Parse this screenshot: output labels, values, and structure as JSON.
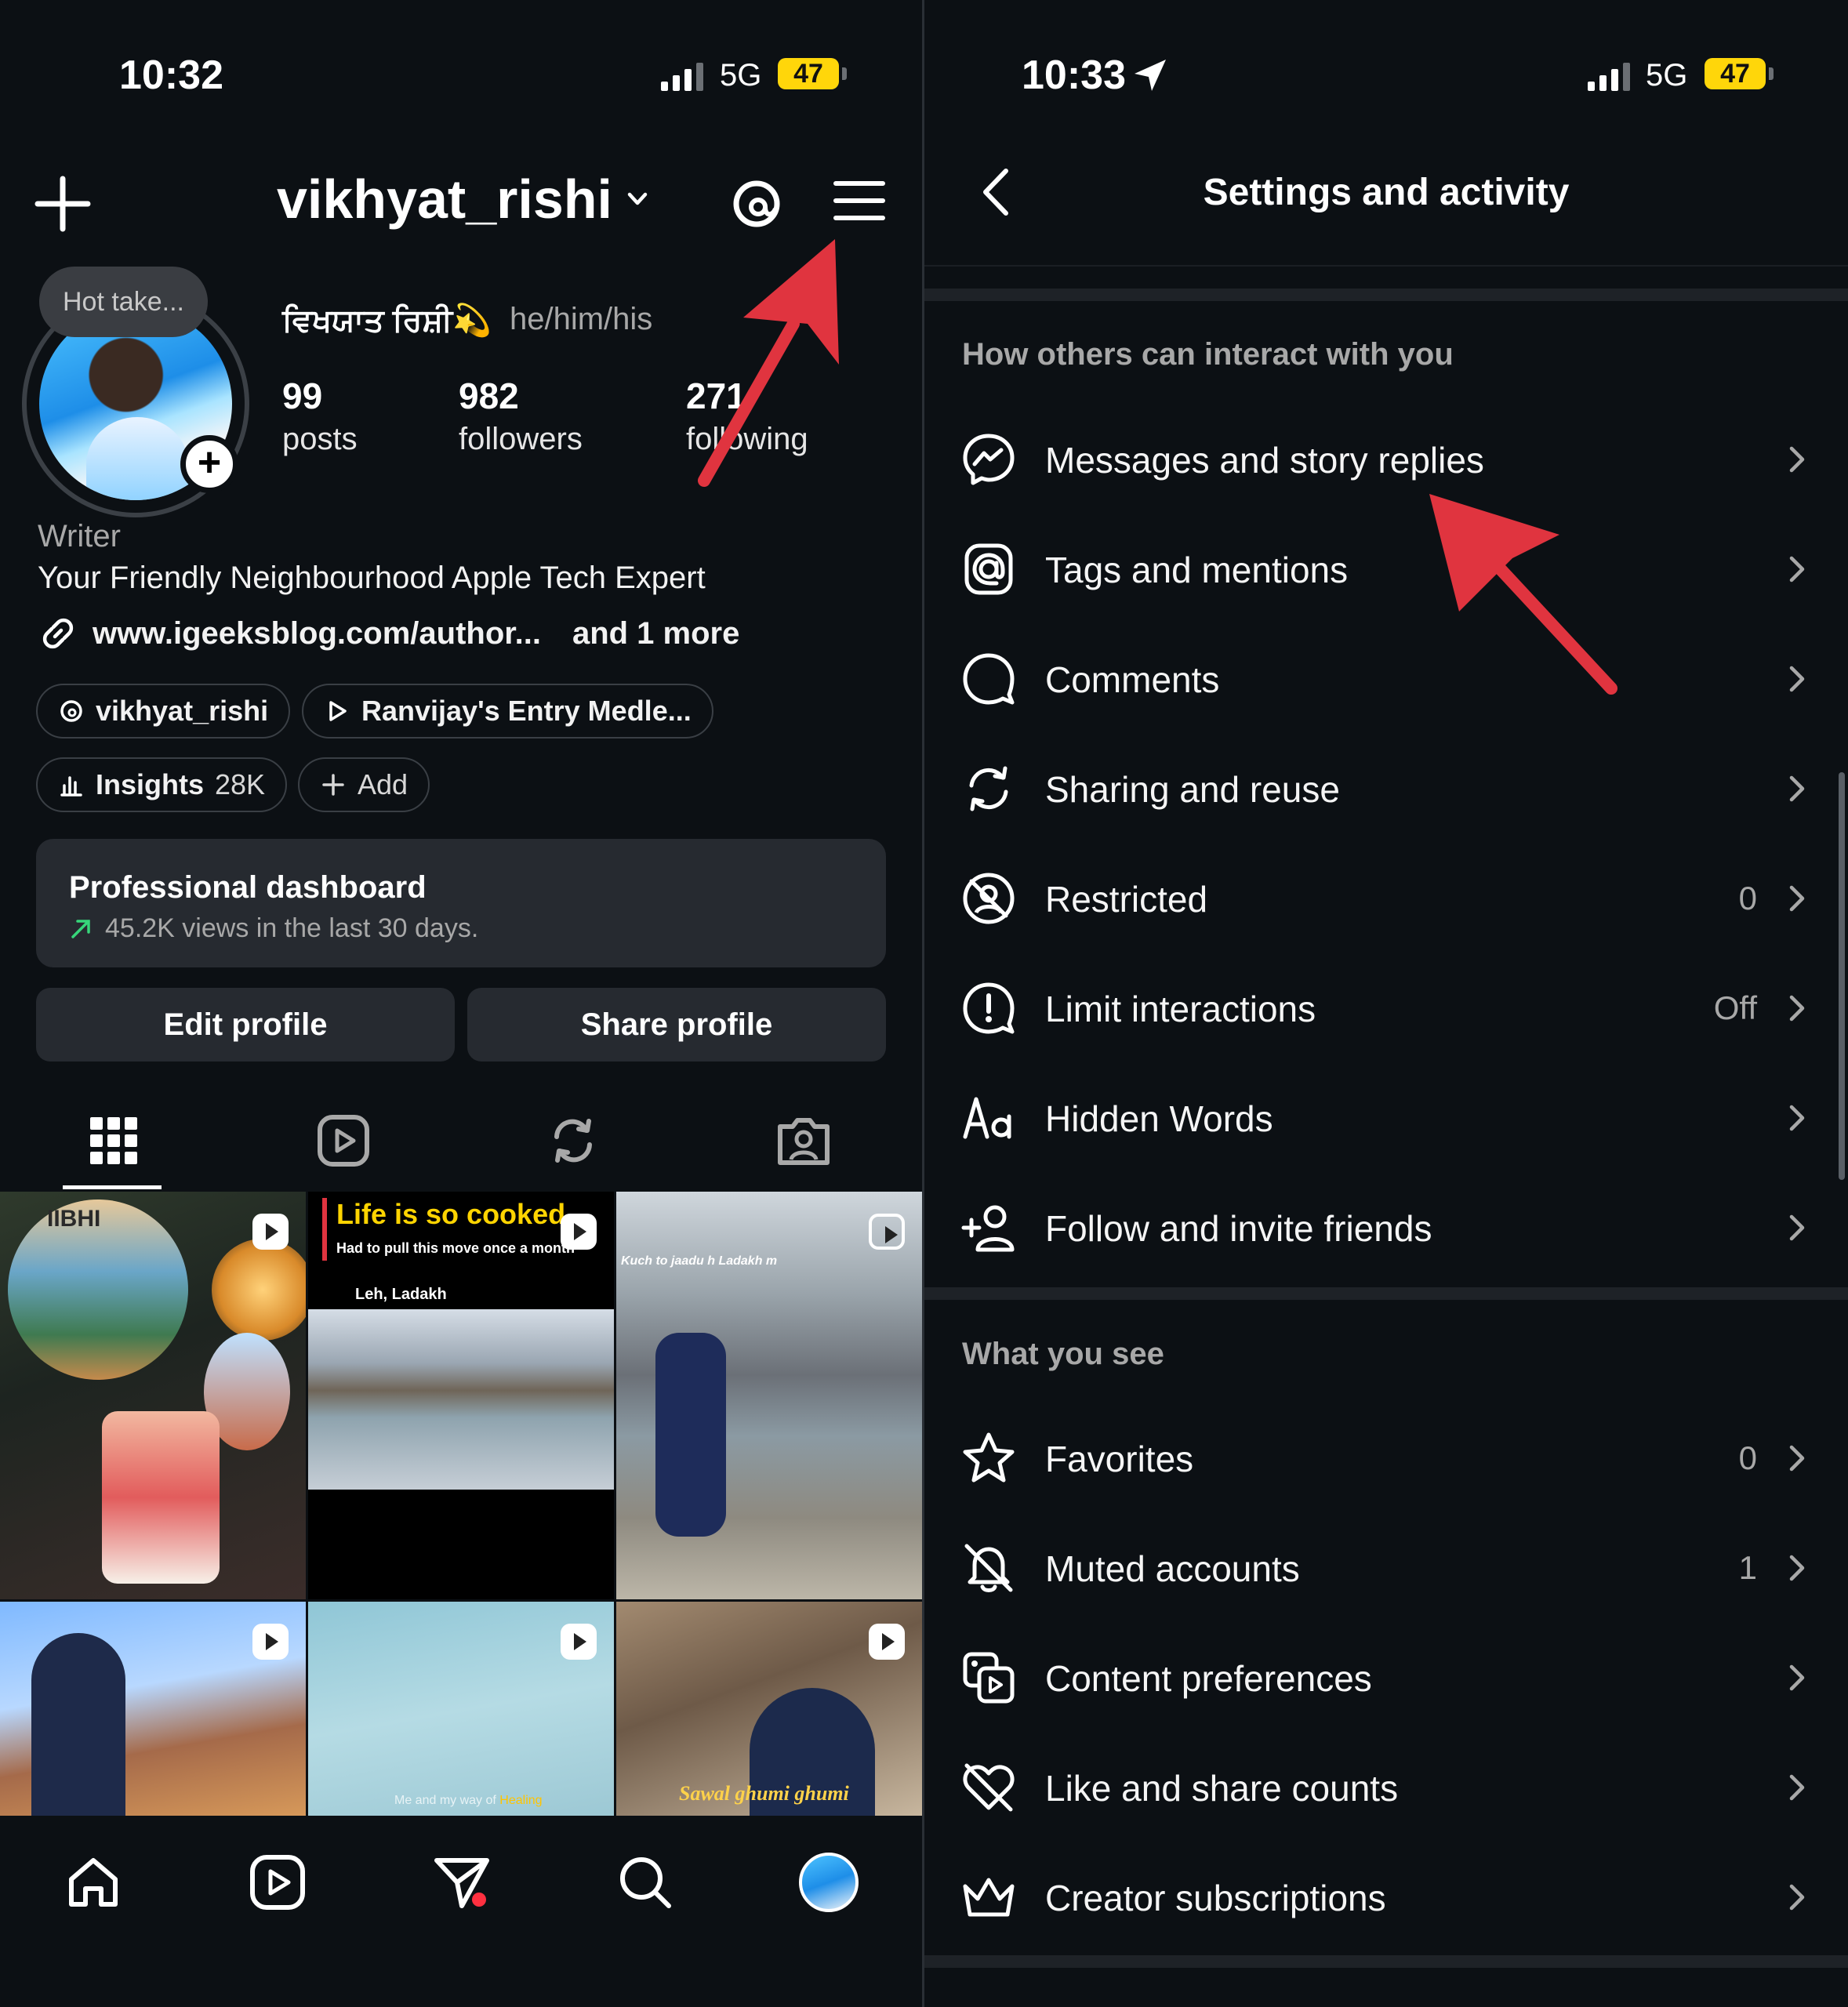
{
  "left": {
    "status": {
      "time": "10:32",
      "network": "5G",
      "battery": "47"
    },
    "header": {
      "username": "vikhyat_rishi"
    },
    "profile": {
      "note": "Hot take...",
      "display_name": "ਵਿਖਯਾਤ ਰਿਸ਼ੀ💫",
      "pronouns": "he/him/his",
      "stats": [
        {
          "value": "99",
          "label": "posts"
        },
        {
          "value": "982",
          "label": "followers"
        },
        {
          "value": "271",
          "label": "following"
        }
      ],
      "category": "Writer",
      "bio": "Your Friendly Neighbourhood Apple Tech Expert",
      "link": "www.igeeksblog.com/author...",
      "link_more": "and 1 more"
    },
    "chips": {
      "threads": "vikhyat_rishi",
      "music": "Ranvijay's Entry Medle...",
      "insights": "Insights",
      "insights_count": "28K",
      "add": "Add"
    },
    "dashboard": {
      "title": "Professional dashboard",
      "subtitle": "45.2K views in the last 30 days."
    },
    "buttons": {
      "edit": "Edit profile",
      "share": "Share profile"
    },
    "grid": {
      "post1_text": "IIBHI",
      "post2_title": "Life is so cooked",
      "post2_sub": "Had to pull this move once a month",
      "post2_loc": "Leh, Ladakh",
      "post3_text": "Kuch to jaadu h Ladakh m",
      "post5_text": "Me and my way of",
      "post5_highlight": "Healing",
      "post6_text": "Sawal ghumi ghumi"
    }
  },
  "right": {
    "status": {
      "time": "10:33",
      "network": "5G",
      "battery": "47"
    },
    "title": "Settings and activity",
    "section1": "How others can interact with you",
    "section2": "What you see",
    "items1": [
      {
        "label": "Messages and story replies",
        "value": "",
        "icon": "messenger-icon"
      },
      {
        "label": "Tags and mentions",
        "value": "",
        "icon": "at-icon"
      },
      {
        "label": "Comments",
        "value": "",
        "icon": "comment-icon"
      },
      {
        "label": "Sharing and reuse",
        "value": "",
        "icon": "repost-icon"
      },
      {
        "label": "Restricted",
        "value": "0",
        "icon": "restricted-icon"
      },
      {
        "label": "Limit interactions",
        "value": "Off",
        "icon": "alert-icon"
      },
      {
        "label": "Hidden Words",
        "value": "",
        "icon": "text-aa-icon"
      },
      {
        "label": "Follow and invite friends",
        "value": "",
        "icon": "add-person-icon"
      }
    ],
    "items2": [
      {
        "label": "Favorites",
        "value": "0",
        "icon": "star-icon"
      },
      {
        "label": "Muted accounts",
        "value": "1",
        "icon": "muted-bell-icon"
      },
      {
        "label": "Content preferences",
        "value": "",
        "icon": "media-icon"
      },
      {
        "label": "Like and share counts",
        "value": "",
        "icon": "heart-off-icon"
      },
      {
        "label": "Creator subscriptions",
        "value": "",
        "icon": "crown-icon"
      }
    ]
  },
  "colors": {
    "background": "#0c1014",
    "surface": "#262a30",
    "annotation_arrow": "#e0343f",
    "battery": "#ffd60a"
  }
}
